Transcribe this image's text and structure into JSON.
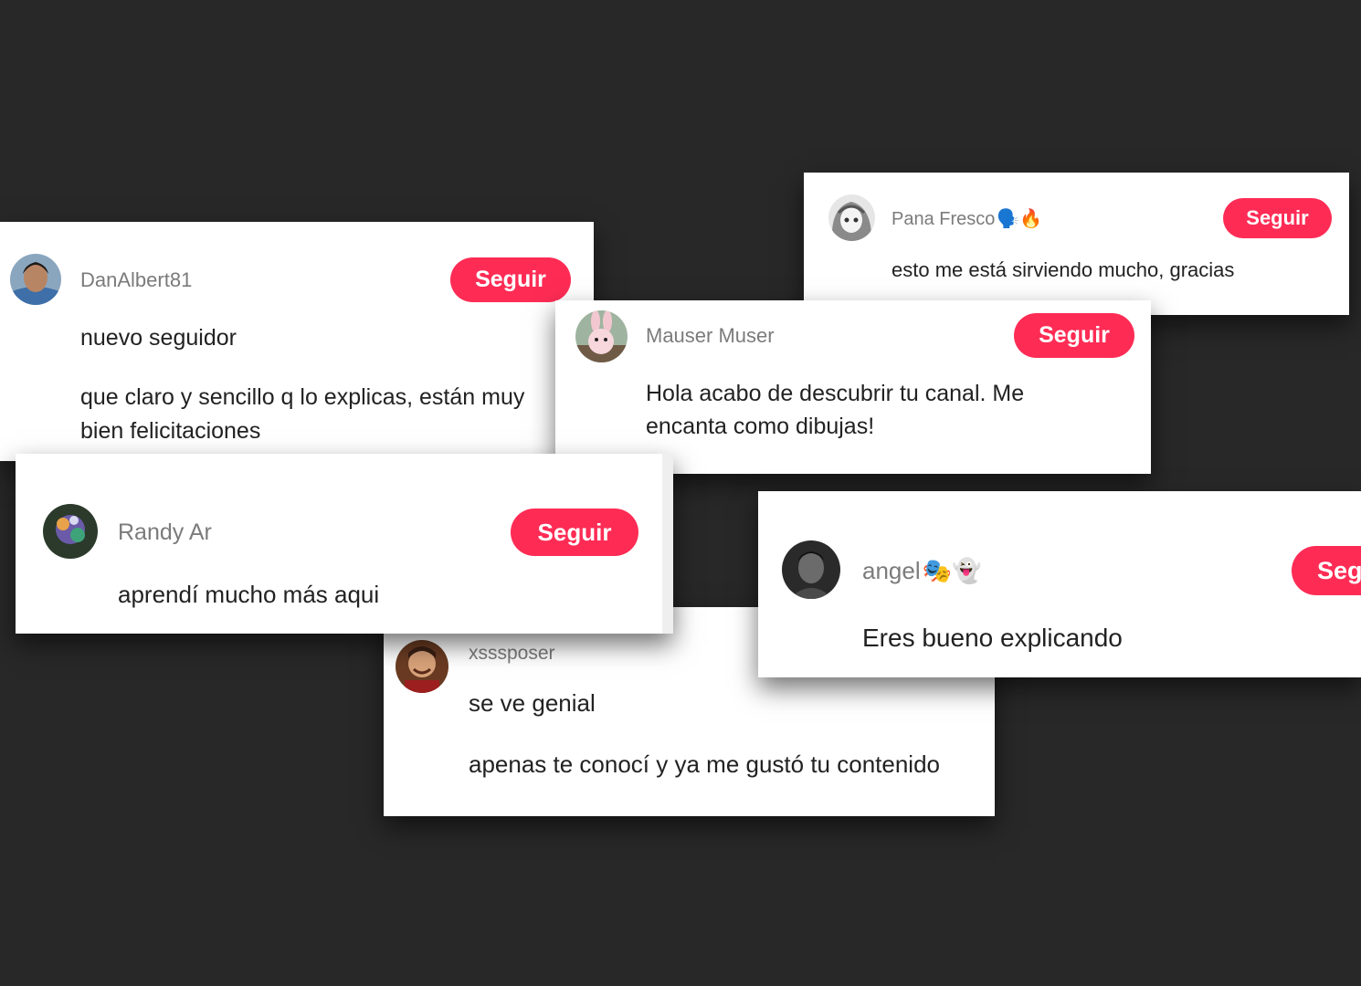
{
  "accent_color": "#fe2c55",
  "comments": [
    {
      "username": "DanAlbert81",
      "lines": [
        "nuevo seguidor",
        "que claro y sencillo q lo explicas, están muy",
        "bien felicitaciones"
      ],
      "button": "Seguir",
      "avatar_icon": "avatar-man-icon"
    },
    {
      "username": "Pana Fresco",
      "username_emoji": "🗣️🔥",
      "lines": [
        "esto me está sirviendo mucho, gracias"
      ],
      "button": "Seguir",
      "avatar_icon": "avatar-anime-girl-icon"
    },
    {
      "username": "Mauser Muser",
      "lines": [
        "Hola acabo de descubrir tu canal. Me",
        "encanta como dibujas!"
      ],
      "button": "Seguir",
      "avatar_icon": "avatar-bunny-icon"
    },
    {
      "username": "Randy Ar",
      "lines": [
        "aprendí mucho más aqui"
      ],
      "button": "Seguir",
      "avatar_icon": "avatar-colorful-icon"
    },
    {
      "username": "angel",
      "username_emoji": "🎭👻",
      "lines": [
        "Eres bueno explicando"
      ],
      "button": "Seguir",
      "avatar_icon": "avatar-dark-icon"
    },
    {
      "username": "xsssposer",
      "lines": [
        "se ve genial",
        "apenas te conocí y ya me gustó tu contenido"
      ],
      "avatar_icon": "avatar-smiling-icon"
    }
  ]
}
